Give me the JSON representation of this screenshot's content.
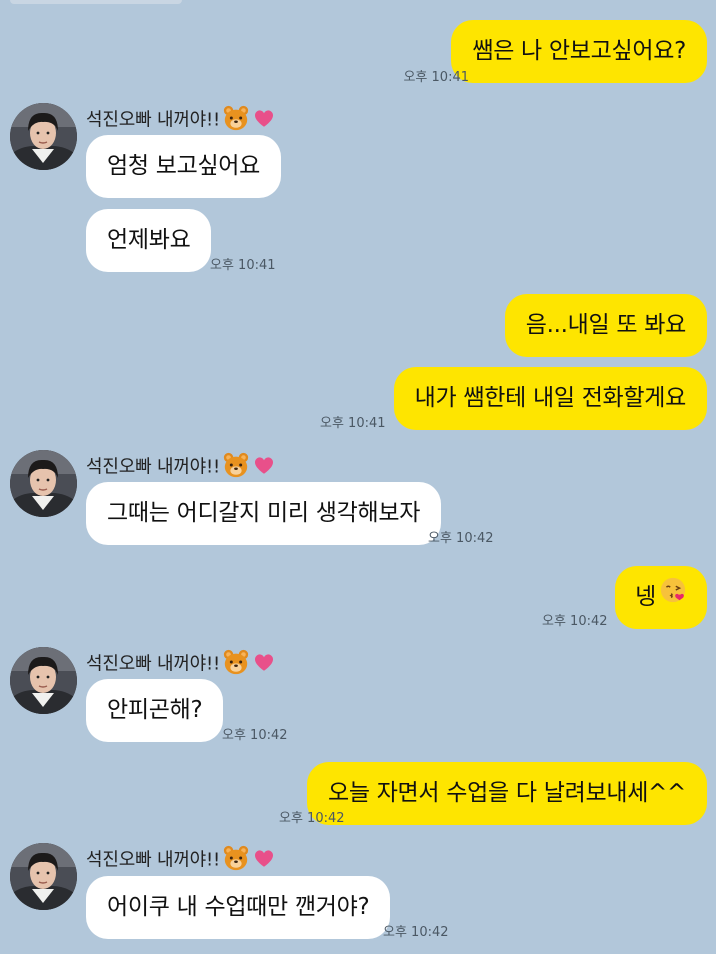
{
  "friend": {
    "name": "석진오빠 내꺼야!!",
    "name_emojis": [
      "bear-face-icon",
      "pink-heart-icon"
    ]
  },
  "messages": [
    {
      "from": "me",
      "text": "쌤은 나 안보고싶어요?",
      "time": "오후 10:41"
    },
    {
      "from": "friend",
      "text": "엄청 보고싶어요",
      "time": ""
    },
    {
      "from": "friend",
      "text": "언제봐요",
      "time": "오후 10:41"
    },
    {
      "from": "me",
      "text": "음...내일 또 봐요",
      "time": ""
    },
    {
      "from": "me",
      "text": "내가 쌤한테 내일 전화할게요",
      "time": "오후 10:41"
    },
    {
      "from": "friend",
      "text": "그때는 어디갈지 미리 생각해보자",
      "time": "오후 10:42"
    },
    {
      "from": "me",
      "text": "넹",
      "emoji": "face-blowing-kiss-icon",
      "time": "오후 10:42"
    },
    {
      "from": "friend",
      "text": "안피곤해?",
      "time": "오후 10:42"
    },
    {
      "from": "me",
      "text": "오늘 자면서 수업을 다 날려보내세^^",
      "time": "오후 10:42"
    },
    {
      "from": "friend",
      "text": "어이쿠 내 수업때만 깬거야?",
      "time": "오후 10:42"
    }
  ],
  "colors": {
    "background": "#b2c7da",
    "my_bubble": "#fee500",
    "friend_bubble": "#ffffff",
    "time_text": "#4b5864"
  }
}
